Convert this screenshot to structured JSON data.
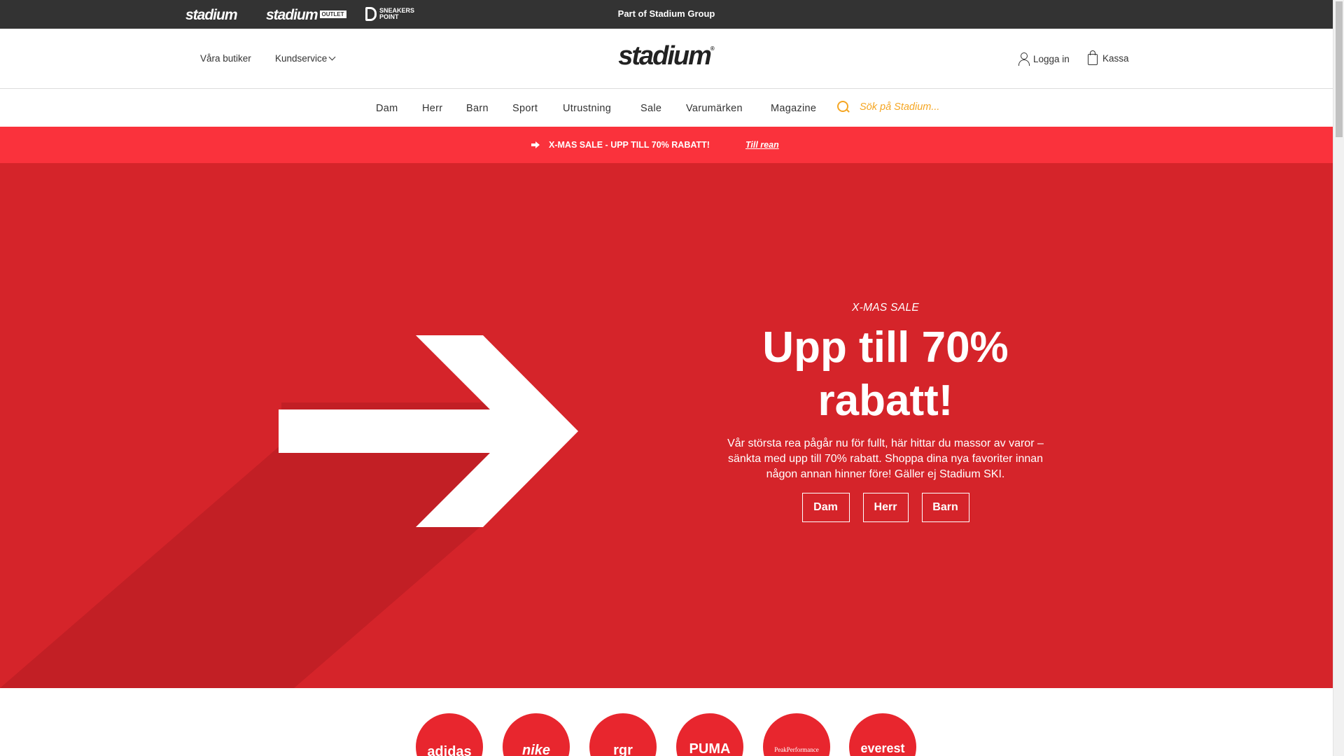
{
  "group_bar": {
    "brands": {
      "stadium": "stadium",
      "stadium_outlet": "stadium",
      "outlet_tag": "OUTLET",
      "sneakers_point": "SNEAKERS POINT"
    },
    "text": "Part of Stadium Group"
  },
  "header": {
    "stores_label": "Våra butiker",
    "service_label": "Kundservice",
    "logo": "stadium",
    "login_label": "Logga in",
    "cart_label": "Kassa"
  },
  "nav": {
    "items": [
      "Dam",
      "Herr",
      "Barn",
      "Sport",
      "Utrustning",
      "Sale",
      "Varumärken",
      "Magazine"
    ],
    "search_placeholder": "Sök på Stadium..."
  },
  "promo": {
    "text": "X-MAS SALE - UPP TILL 70% RABATT!",
    "link": "Till rean"
  },
  "hero": {
    "kicker": "X-MAS SALE",
    "title": "Upp till 70% rabatt!",
    "description": "Vår största rea pågår nu för fullt, här hittar du massor av varor – sänkta med upp till 70% rabatt. Shoppa dina nya favoriter innan någon annan hinner före! Gäller ej Stadium SKI.",
    "buttons": [
      "Dam",
      "Herr",
      "Barn"
    ]
  },
  "brands": [
    "adidas",
    "nike",
    "rgr",
    "PUMA",
    "PeakPerformance",
    "everest"
  ],
  "colors": {
    "topbar": "#333333",
    "promo": "#fa323c",
    "hero": "#d5242a",
    "search_accent": "#f5a623",
    "brand_circle": "#e8262e"
  }
}
